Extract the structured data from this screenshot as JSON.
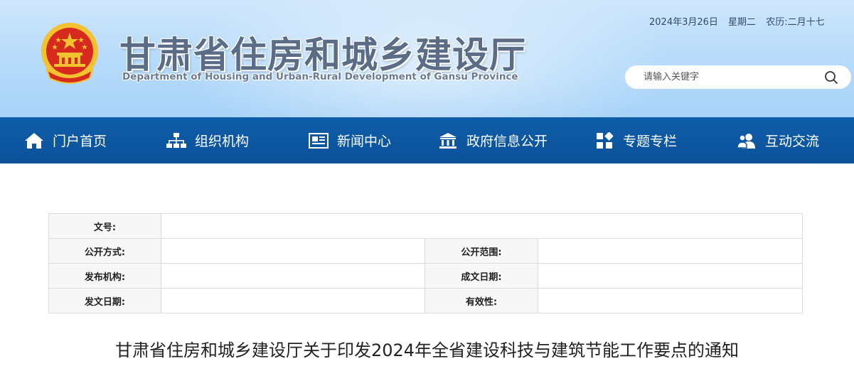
{
  "header": {
    "title": "甘肃省住房和城乡建设厅",
    "subtitle": "Department of Housing and Urban-Rural Development of Gansu Province",
    "date": "2024年3月26日",
    "weekday": "星期二",
    "lunar": "农历:二月十七",
    "emblem_icon": "national-emblem-icon",
    "search": {
      "placeholder": "请输入关键字",
      "value": ""
    }
  },
  "nav": {
    "items": [
      {
        "label": "门户首页",
        "icon": "home-icon"
      },
      {
        "label": "组织机构",
        "icon": "org-chart-icon"
      },
      {
        "label": "新闻中心",
        "icon": "news-icon"
      },
      {
        "label": "政府信息公开",
        "icon": "government-building-icon"
      },
      {
        "label": "专题专栏",
        "icon": "grid-icon"
      },
      {
        "label": "互动交流",
        "icon": "users-icon"
      }
    ]
  },
  "info": {
    "doc_no_label": "文号:",
    "doc_no_value": "",
    "disclosure_method_label": "公开方式:",
    "disclosure_method_value": "",
    "disclosure_scope_label": "公开范围:",
    "disclosure_scope_value": "",
    "issuer_label": "发布机构:",
    "issuer_value": "",
    "created_date_label": "成文日期:",
    "created_date_value": "",
    "issue_date_label": "发文日期:",
    "issue_date_value": "",
    "validity_label": "有效性:",
    "validity_value": ""
  },
  "article": {
    "title": "甘肃省住房和城乡建设厅关于印发2024年全省建设科技与建筑节能工作要点的通知"
  },
  "colors": {
    "nav_bg": "#0f5da8",
    "header_bg": "#b9dcfa",
    "emblem_red": "#d62a1f",
    "emblem_gold": "#f2c230"
  }
}
